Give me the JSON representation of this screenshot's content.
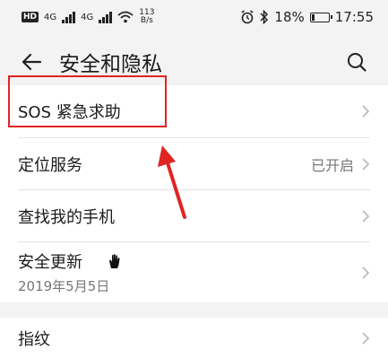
{
  "status_bar": {
    "hd": "HD",
    "signal1": "4G",
    "signal2": "4G",
    "speed_value": "113",
    "speed_unit": "B/s",
    "battery": "18%",
    "time": "17:55"
  },
  "header": {
    "title": "安全和隐私"
  },
  "settings": {
    "items": [
      {
        "label": "SOS 紧急求助"
      },
      {
        "label": "定位服务",
        "value": "已开启"
      },
      {
        "label": "查找我的手机"
      },
      {
        "label": "安全更新",
        "sublabel": "2019年5月5日"
      },
      {
        "label": "指纹"
      }
    ]
  },
  "colors": {
    "highlight": "#e02424",
    "background": "#f3f3f3",
    "card": "#ffffff"
  }
}
